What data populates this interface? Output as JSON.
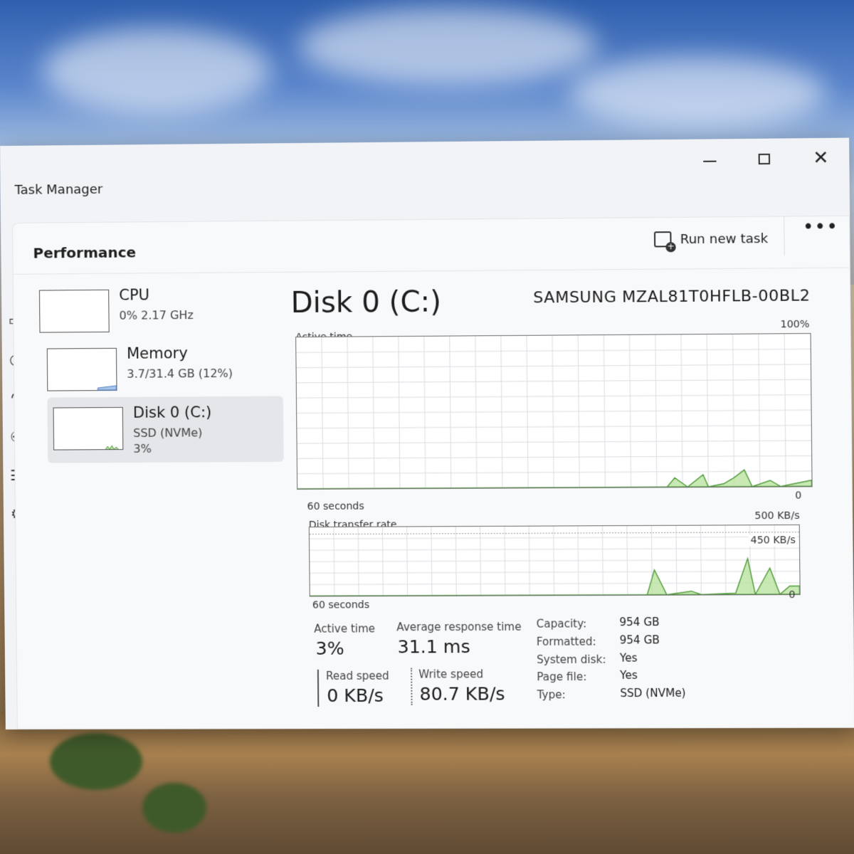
{
  "window": {
    "title": "Task Manager"
  },
  "panel": {
    "title": "Performance",
    "run_new_task": "Run new task",
    "more": "•••"
  },
  "devices": [
    {
      "name": "CPU",
      "line1": "0%  2.17 GHz",
      "line2": ""
    },
    {
      "name": "Memory",
      "line1": "3.7/31.4 GB (12%)",
      "line2": ""
    },
    {
      "name": "Disk 0 (C:)",
      "line1": "SSD (NVMe)",
      "line2": "3%"
    }
  ],
  "disk": {
    "title": "Disk 0 (C:)",
    "model": "SAMSUNG MZAL81T0HFLB-00BL2",
    "active_graph": {
      "label": "Active time",
      "max": "100%",
      "min": "0",
      "span": "60 seconds"
    },
    "transfer_graph": {
      "label": "Disk transfer rate",
      "max": "500 KB/s",
      "marker": "450 KB/s",
      "min": "0",
      "span": "60 seconds"
    }
  },
  "stats": {
    "active_time_label": "Active time",
    "active_time": "3%",
    "avg_response_label": "Average response time",
    "avg_response": "31.1 ms",
    "read_label": "Read speed",
    "read": "0 KB/s",
    "write_label": "Write speed",
    "write": "80.7 KB/s"
  },
  "properties": [
    {
      "k": "Capacity:",
      "v": "954 GB"
    },
    {
      "k": "Formatted:",
      "v": "954 GB"
    },
    {
      "k": "System disk:",
      "v": "Yes"
    },
    {
      "k": "Page file:",
      "v": "Yes"
    },
    {
      "k": "Type:",
      "v": "SSD (NVMe)"
    }
  ],
  "colors": {
    "graph_fill": "#b6e29a",
    "graph_line": "#4f9a3a",
    "grid": "#d9dde2"
  }
}
